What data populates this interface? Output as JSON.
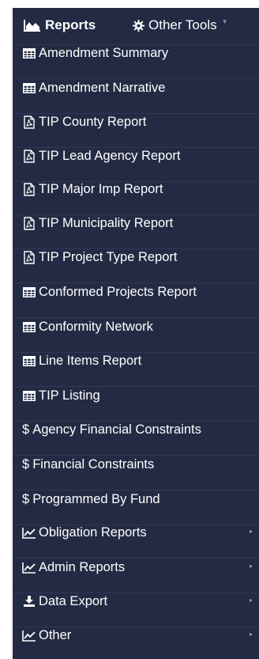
{
  "topbar": {
    "reports_label": "Reports",
    "reports_icon": "area-chart-icon",
    "other_tools_label": "Other Tools",
    "other_tools_icon": "gear-icon",
    "caret": "▼"
  },
  "items": [
    {
      "label": "Amendment Summary",
      "icon": "table-icon"
    },
    {
      "label": "Amendment Narrative",
      "icon": "table-icon"
    },
    {
      "label": "TIP County Report",
      "icon": "pdf-file-icon"
    },
    {
      "label": "TIP Lead Agency Report",
      "icon": "pdf-file-icon"
    },
    {
      "label": "TIP Major Imp Report",
      "icon": "pdf-file-icon"
    },
    {
      "label": "TIP Municipality Report",
      "icon": "pdf-file-icon"
    },
    {
      "label": "TIP Project Type Report",
      "icon": "pdf-file-icon"
    },
    {
      "label": "Conformed Projects Report",
      "icon": "table-icon"
    },
    {
      "label": "Conformity Network",
      "icon": "table-icon"
    },
    {
      "label": "Line Items Report",
      "icon": "table-icon"
    },
    {
      "label": "TIP Listing",
      "icon": "table-icon"
    },
    {
      "label": "Agency Financial Constraints",
      "icon": "dollar-icon",
      "glyph": "$"
    },
    {
      "label": "Financial Constraints",
      "icon": "dollar-icon",
      "glyph": "$"
    },
    {
      "label": "Programmed By Fund",
      "icon": "dollar-icon",
      "glyph": "$"
    },
    {
      "label": "Obligation Reports",
      "icon": "line-chart-icon",
      "caret": "▸"
    },
    {
      "label": "Admin Reports",
      "icon": "line-chart-icon",
      "caret": "▸"
    },
    {
      "label": "Data Export",
      "icon": "download-icon",
      "caret": "▸"
    },
    {
      "label": "Other",
      "icon": "line-chart-icon",
      "caret": "▸"
    }
  ],
  "colors": {
    "menu_background": "#232b44",
    "text": "#ffffff",
    "caret": "#9aa0b5"
  }
}
